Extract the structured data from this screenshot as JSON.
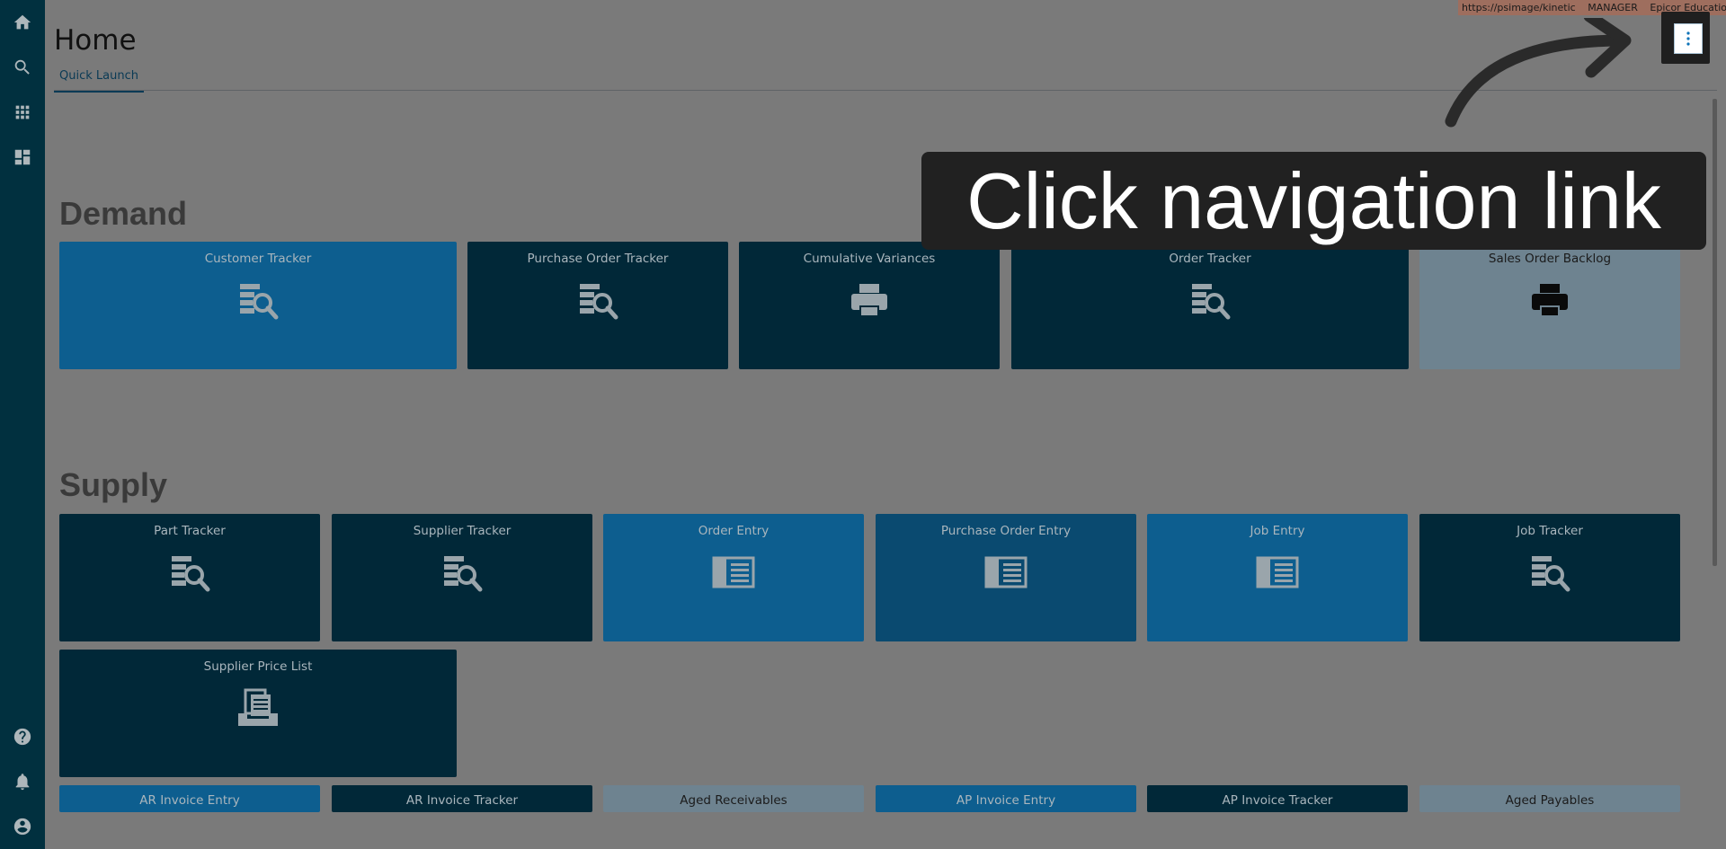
{
  "header": {
    "title": "Home",
    "tab_label": "Quick Launch",
    "url_items": [
      "https://psimage/kinetic",
      "MANAGER",
      "Epicor Education"
    ]
  },
  "callout": {
    "text": "Click navigation link"
  },
  "sidebar": {
    "icons": [
      "home-icon",
      "search-icon",
      "apps-grid-icon",
      "dashboard-icon",
      "help-icon",
      "bell-icon",
      "account-icon"
    ]
  },
  "sections": {
    "demand": {
      "title": "Demand",
      "tiles": [
        {
          "label": "Customer Tracker",
          "icon": "tracker-search-icon"
        },
        {
          "label": "Purchase Order Tracker",
          "icon": "tracker-search-icon"
        },
        {
          "label": "Cumulative Variances",
          "icon": "printer-icon"
        },
        {
          "label": "Order Tracker",
          "icon": "tracker-search-icon"
        },
        {
          "label": "Sales Order Backlog",
          "icon": "printer-icon"
        }
      ]
    },
    "supply": {
      "title": "Supply",
      "tiles": [
        {
          "label": "Part Tracker",
          "icon": "tracker-search-icon"
        },
        {
          "label": "Supplier Tracker",
          "icon": "tracker-search-icon"
        },
        {
          "label": "Order Entry",
          "icon": "entry-form-icon"
        },
        {
          "label": "Purchase Order Entry",
          "icon": "entry-form-icon"
        },
        {
          "label": "Job Entry",
          "icon": "entry-form-icon"
        },
        {
          "label": "Job Tracker",
          "icon": "tracker-search-icon"
        },
        {
          "label": "Supplier Price List",
          "icon": "document-tray-icon"
        }
      ]
    },
    "finance": {
      "tiles": [
        {
          "label": "AR Invoice Entry"
        },
        {
          "label": "AR Invoice Tracker"
        },
        {
          "label": "Aged Receivables"
        },
        {
          "label": "AP Invoice Entry"
        },
        {
          "label": "AP Invoice Tracker"
        },
        {
          "label": "Aged Payables"
        }
      ]
    }
  },
  "colors": {
    "sidebar": "#01303f",
    "overlay": "#7a7a7a",
    "tile_navy": "#012838",
    "tile_blue": "#0d5e8f",
    "tile_gray": "#6e8390"
  }
}
